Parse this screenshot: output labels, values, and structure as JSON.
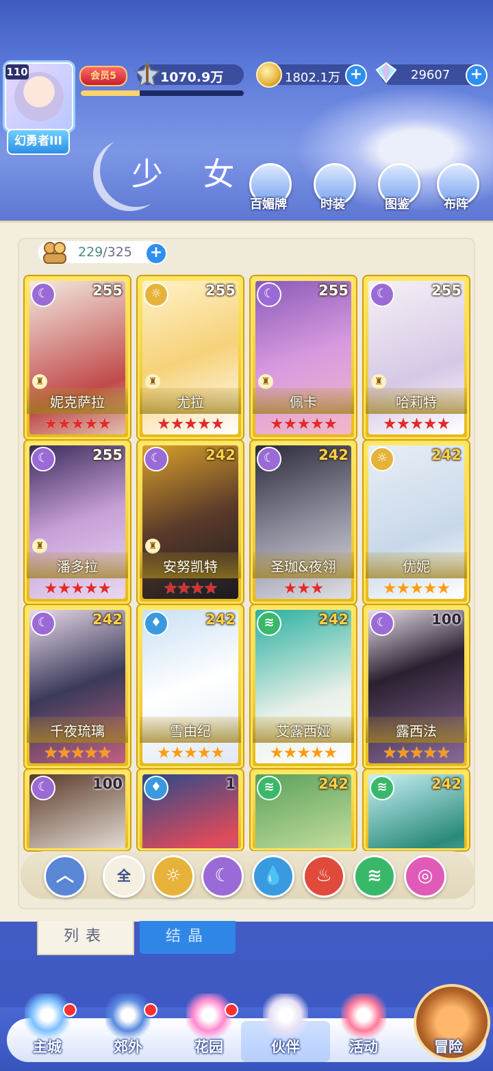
{
  "header": {
    "level": "110",
    "title": "幻勇者III",
    "vip_label": "会员5",
    "vip_progress": 0.36,
    "power": "1070.9万",
    "gold": "1802.1万",
    "gems": "29607",
    "plus": "+"
  },
  "banner": {
    "title": "少 女",
    "buttons": [
      {
        "label": "百媚牌",
        "icon": "card-badge-icon"
      },
      {
        "label": "时装",
        "icon": "outfit-icon"
      },
      {
        "label": "图鉴",
        "icon": "book-icon"
      },
      {
        "label": "布阵",
        "icon": "grid-formation-icon"
      }
    ]
  },
  "collection": {
    "count": "229",
    "max": "/325"
  },
  "cards": [
    {
      "name": "妮克萨拉",
      "level": "255",
      "element": "moon",
      "stars": 5,
      "star_color": "red",
      "pawn": true
    },
    {
      "name": "尤拉",
      "level": "255",
      "element": "sun",
      "stars": 5,
      "star_color": "red",
      "pawn": true
    },
    {
      "name": "佩卡",
      "level": "255",
      "element": "moon",
      "stars": 5,
      "star_color": "red",
      "pawn": true
    },
    {
      "name": "哈莉特",
      "level": "255",
      "element": "moon",
      "stars": 5,
      "star_color": "red",
      "pawn": true
    },
    {
      "name": "潘多拉",
      "level": "255",
      "element": "moon",
      "stars": 5,
      "star_color": "red",
      "pawn": true
    },
    {
      "name": "安努凯特",
      "level": "242",
      "element": "moon",
      "stars": 4,
      "star_color": "red",
      "pawn": true
    },
    {
      "name": "圣珈&夜翎",
      "level": "242",
      "element": "moon",
      "stars": 3,
      "star_color": "red",
      "pawn": false
    },
    {
      "name": "优妮",
      "level": "242",
      "element": "sun",
      "stars": 5,
      "star_color": "gold",
      "pawn": false
    },
    {
      "name": "千夜琉璃",
      "level": "242",
      "element": "moon",
      "stars": 5,
      "star_color": "gold",
      "pawn": false
    },
    {
      "name": "雪由纪",
      "level": "242",
      "element": "water",
      "stars": 5,
      "star_color": "gold",
      "pawn": false
    },
    {
      "name": "艾露西娅",
      "level": "242",
      "element": "wind",
      "stars": 5,
      "star_color": "gold",
      "pawn": false
    },
    {
      "name": "露西法",
      "level": "100",
      "element": "moon",
      "stars": 5,
      "star_color": "gold",
      "pawn": false
    },
    {
      "name": "",
      "level": "100",
      "element": "moon",
      "stars": 0,
      "star_color": "gold",
      "pawn": false
    },
    {
      "name": "",
      "level": "1",
      "element": "water",
      "stars": 0,
      "star_color": "gold",
      "pawn": false
    },
    {
      "name": "",
      "level": "242",
      "element": "wind",
      "stars": 0,
      "star_color": "gold",
      "pawn": false
    },
    {
      "name": "",
      "level": "242",
      "element": "wind",
      "stars": 0,
      "star_color": "gold",
      "pawn": false
    }
  ],
  "filters": [
    {
      "id": "collapse",
      "label": "︿",
      "color": "#5a86d6"
    },
    {
      "id": "all",
      "label": "全",
      "color": "#f4efe0"
    },
    {
      "id": "sun",
      "label": "☼",
      "color": "#e7b23a"
    },
    {
      "id": "moon",
      "label": "☾",
      "color": "#9a6ad6"
    },
    {
      "id": "water",
      "label": "💧",
      "color": "#3a9ae0"
    },
    {
      "id": "fire",
      "label": "♨",
      "color": "#e04a3a"
    },
    {
      "id": "wind",
      "label": "≋",
      "color": "#3ab86a"
    },
    {
      "id": "heart",
      "label": "◎",
      "color": "#e05ab8"
    }
  ],
  "tabs": {
    "list": "列表",
    "crystal": "结晶"
  },
  "nav": [
    {
      "label": "主城",
      "dot": true
    },
    {
      "label": "郊外",
      "dot": true
    },
    {
      "label": "花园",
      "dot": true
    },
    {
      "label": "伙伴",
      "dot": false,
      "active": true
    },
    {
      "label": "活动",
      "dot": false
    },
    {
      "label": "冒险",
      "dot": false
    }
  ],
  "colors": {
    "accent": "#2f8ff0",
    "card_gold": "#f2c926",
    "star_red": "#e12a2a",
    "star_gold": "#ff9a12"
  }
}
